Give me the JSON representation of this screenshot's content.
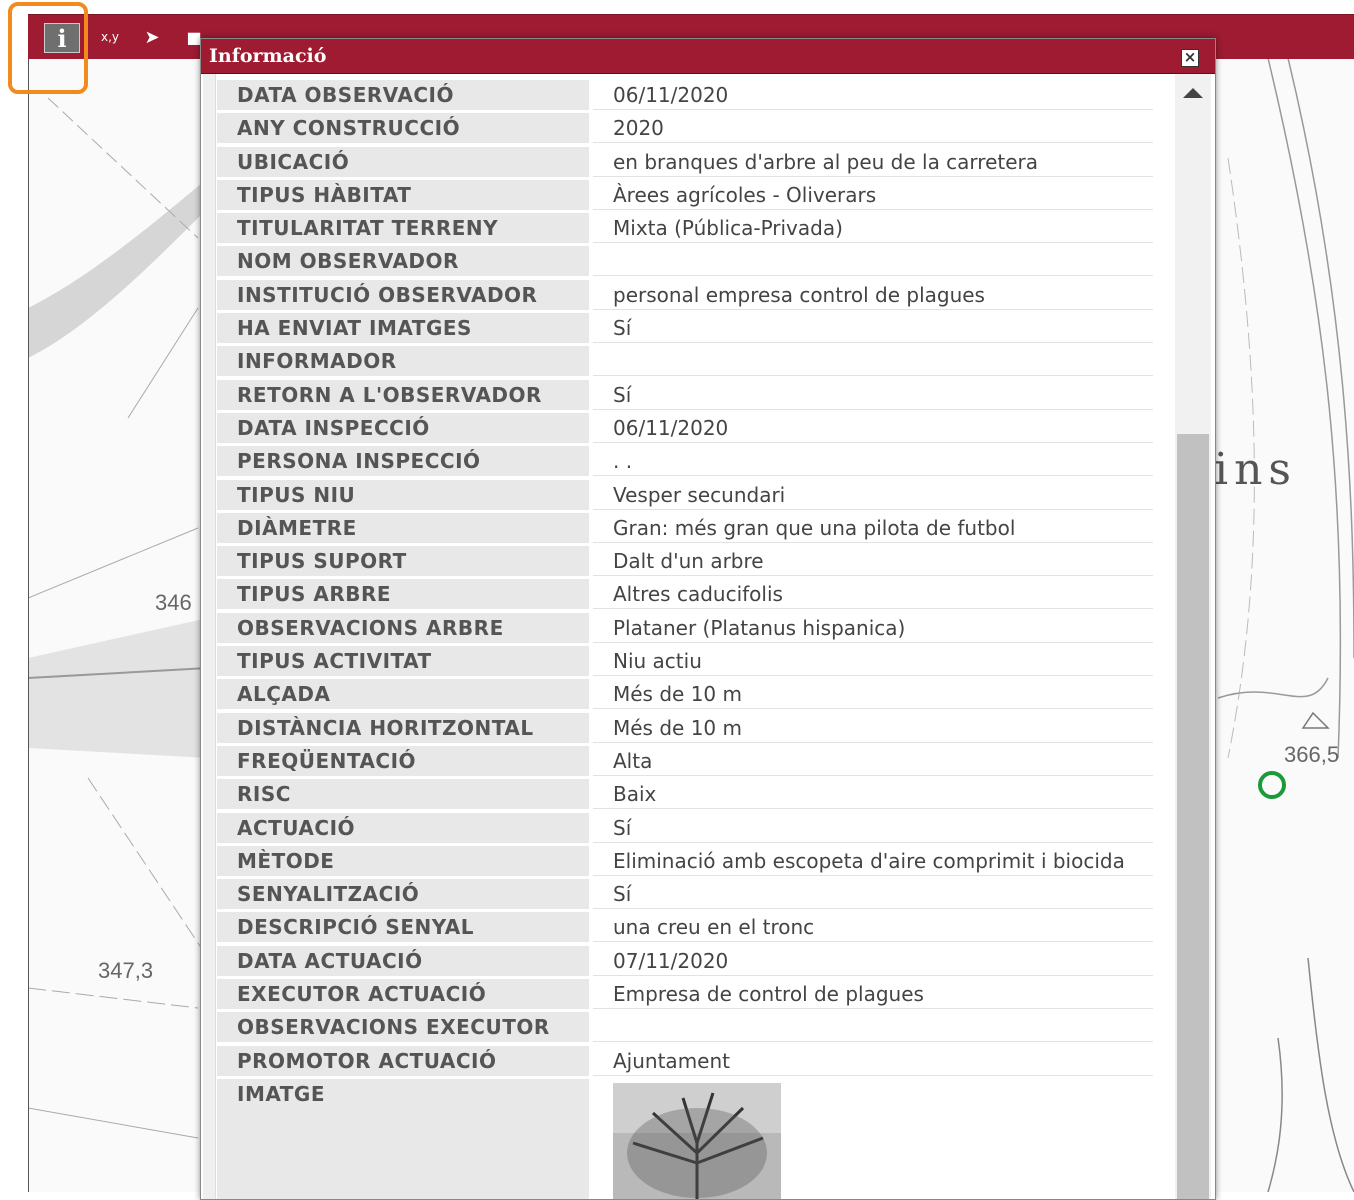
{
  "toolbar": {
    "info_glyph": "i",
    "xy_label": "x,y",
    "select_label": "x,y",
    "tools": [
      "info-tool",
      "coordinates-tool",
      "select-tool",
      "comment-tool"
    ]
  },
  "dialog": {
    "title": "Informació",
    "close_glyph": "×",
    "fields": [
      {
        "label": "DATA OBSERVACIÓ",
        "value": "06/11/2020"
      },
      {
        "label": "ANY CONSTRUCCIÓ",
        "value": "2020"
      },
      {
        "label": "UBICACIÓ",
        "value": "en branques d'arbre al peu de la carretera"
      },
      {
        "label": "TIPUS HÀBITAT",
        "value": "Àrees agrícoles - Oliverars"
      },
      {
        "label": "TITULARITAT TERRENY",
        "value": "Mixta (Pública-Privada)"
      },
      {
        "label": "NOM OBSERVADOR",
        "value": ""
      },
      {
        "label": "INSTITUCIÓ OBSERVADOR",
        "value": "personal empresa control de plagues"
      },
      {
        "label": "HA ENVIAT IMATGES",
        "value": "Sí"
      },
      {
        "label": "INFORMADOR",
        "value": ""
      },
      {
        "label": "RETORN A L'OBSERVADOR",
        "value": "Sí"
      },
      {
        "label": "DATA INSPECCIÓ",
        "value": "06/11/2020"
      },
      {
        "label": "PERSONA INSPECCIÓ",
        "value": ". ."
      },
      {
        "label": "TIPUS NIU",
        "value": "Vesper secundari"
      },
      {
        "label": "DIÀMETRE",
        "value": "Gran: més gran que una pilota de futbol"
      },
      {
        "label": "TIPUS SUPORT",
        "value": "Dalt d'un arbre"
      },
      {
        "label": "TIPUS ARBRE",
        "value": "Altres caducifolis"
      },
      {
        "label": "OBSERVACIONS ARBRE",
        "value": "Plataner (Platanus hispanica)"
      },
      {
        "label": "TIPUS ACTIVITAT",
        "value": "Niu actiu"
      },
      {
        "label": "ALÇADA",
        "value": "Més de 10 m"
      },
      {
        "label": "DISTÀNCIA HORITZONTAL",
        "value": "Més de 10 m"
      },
      {
        "label": "FREQÜENTACIÓ",
        "value": "Alta"
      },
      {
        "label": "RISC",
        "value": "Baix"
      },
      {
        "label": "ACTUACIÓ",
        "value": "Sí"
      },
      {
        "label": "MÈTODE",
        "value": "Eliminació amb escopeta d'aire comprimit i biocida"
      },
      {
        "label": "SENYALITZACIÓ",
        "value": "Sí"
      },
      {
        "label": "DESCRIPCIÓ SENYAL",
        "value": "una creu en el tronc"
      },
      {
        "label": "DATA ACTUACIÓ",
        "value": "07/11/2020"
      },
      {
        "label": "EXECUTOR ACTUACIÓ",
        "value": "Empresa de control de plagues"
      },
      {
        "label": "OBSERVACIONS EXECUTOR",
        "value": ""
      },
      {
        "label": "PROMOTOR ACTUACIÓ",
        "value": "Ajuntament"
      }
    ],
    "image_label": "IMATGE"
  },
  "map": {
    "labels": {
      "elev_346": "346",
      "elev_347": "347,3",
      "elev_366": "366,5",
      "place_fragment": "ins"
    }
  },
  "colors": {
    "toolbar": "#9e1b32",
    "highlight": "#f28a1e",
    "marker": "#1a9a3a"
  }
}
